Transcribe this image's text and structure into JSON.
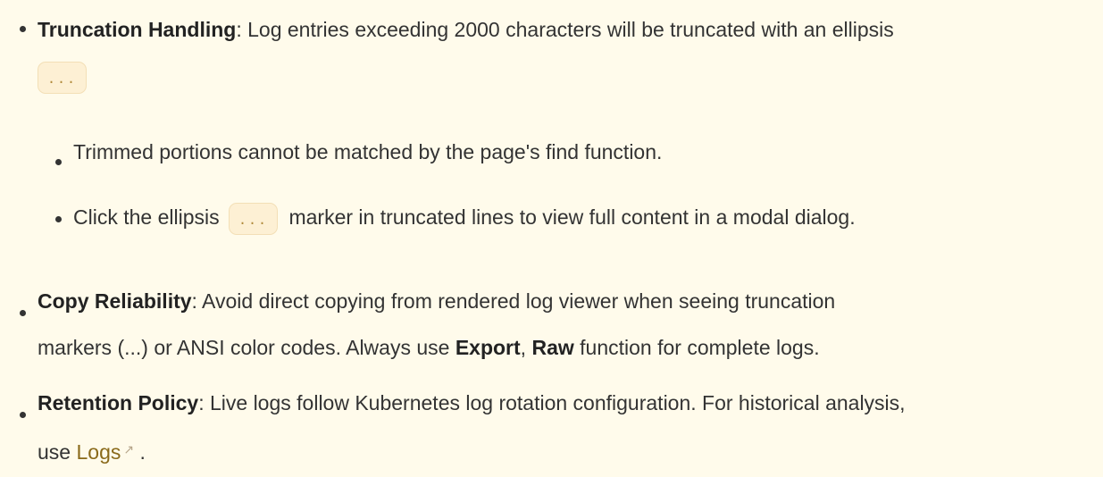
{
  "items": [
    {
      "title": "Truncation Handling",
      "text_1": ": Log entries exceeding 2000 characters will be truncated with an ellipsis",
      "code": "...",
      "sub_items": [
        {
          "text": "Trimmed portions cannot be matched by the page's find function."
        },
        {
          "text_before": "Click the ellipsis",
          "code": "...",
          "text_after": "marker in truncated lines to view full content in a modal dialog."
        }
      ]
    },
    {
      "title": "Copy Reliability",
      "line1": ": Avoid direct copying from rendered log viewer when seeing truncation",
      "line2_a": "markers (...) or ANSI color codes. Always use ",
      "bold_export": "Export",
      "line2_b": ", ",
      "bold_raw": "Raw",
      "line2_c": " function for complete logs."
    },
    {
      "title": "Retention Policy",
      "line1": ": Live logs follow Kubernetes log rotation configuration. For historical analysis,",
      "line2_a": "use ",
      "link_label": "Logs",
      "line2_b": " ."
    }
  ],
  "colors": {
    "background": "#fffbeb",
    "text": "#333333",
    "code_text": "#b08a3a",
    "code_bg": "#fdf0d4",
    "link": "#8a6a1a"
  },
  "icons": {
    "external_link": "external-link-icon"
  }
}
